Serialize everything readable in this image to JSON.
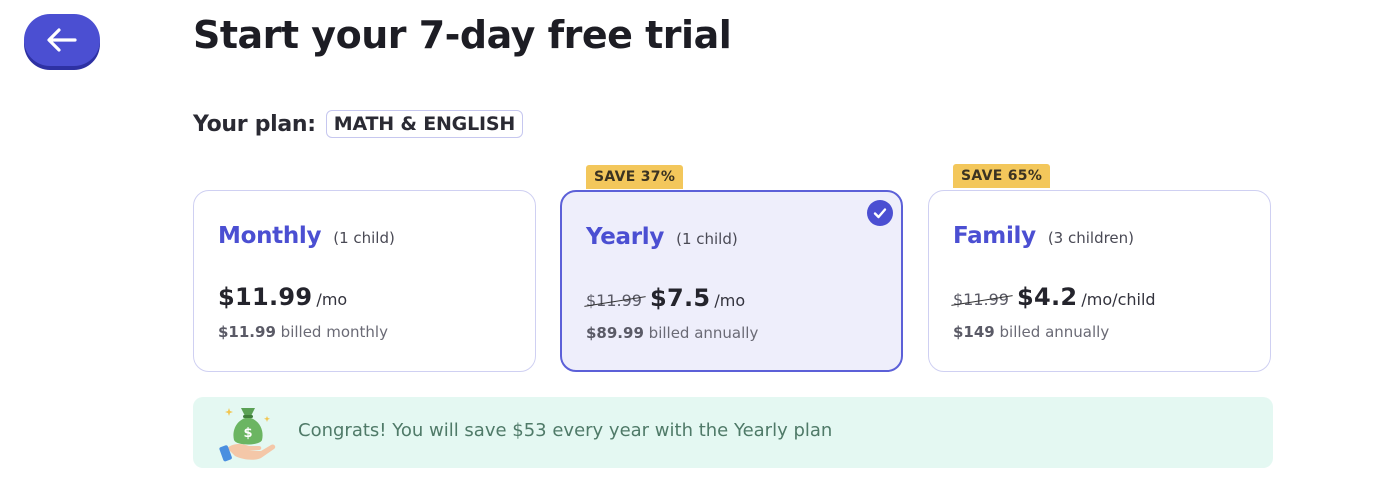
{
  "header": {
    "back_icon": "arrow-left-icon",
    "title": "Start your 7-day free trial"
  },
  "plan": {
    "label": "Your plan:",
    "value": "MATH & ENGLISH"
  },
  "cards": [
    {
      "name": "Monthly",
      "sub": "(1 child)",
      "badge": "",
      "old_price": "",
      "price": "$11.99",
      "unit": "/mo",
      "billed_amount": "$11.99",
      "billed_text": "billed monthly",
      "selected": false
    },
    {
      "name": "Yearly",
      "sub": "(1 child)",
      "badge": "SAVE 37%",
      "old_price": "$11.99",
      "price": "$7.5",
      "unit": "/mo",
      "billed_amount": "$89.99",
      "billed_text": "billed annually",
      "selected": true,
      "selected_icon": "check-circle-icon"
    },
    {
      "name": "Family",
      "sub": "(3 children)",
      "badge": "SAVE 65%",
      "old_price": "$11.99",
      "price": "$4.2",
      "unit": "/mo/child",
      "billed_amount": "$149",
      "billed_text": "billed annually",
      "selected": false
    }
  ],
  "congrats": {
    "icon": "money-bag-hand-icon",
    "text": "Congrats! You will save $53 every year with the Yearly plan"
  },
  "colors": {
    "accent": "#4b4fd2",
    "badge": "#f3c75b",
    "congrats_bg": "#e4f8f2",
    "congrats_text": "#4f7a68"
  }
}
